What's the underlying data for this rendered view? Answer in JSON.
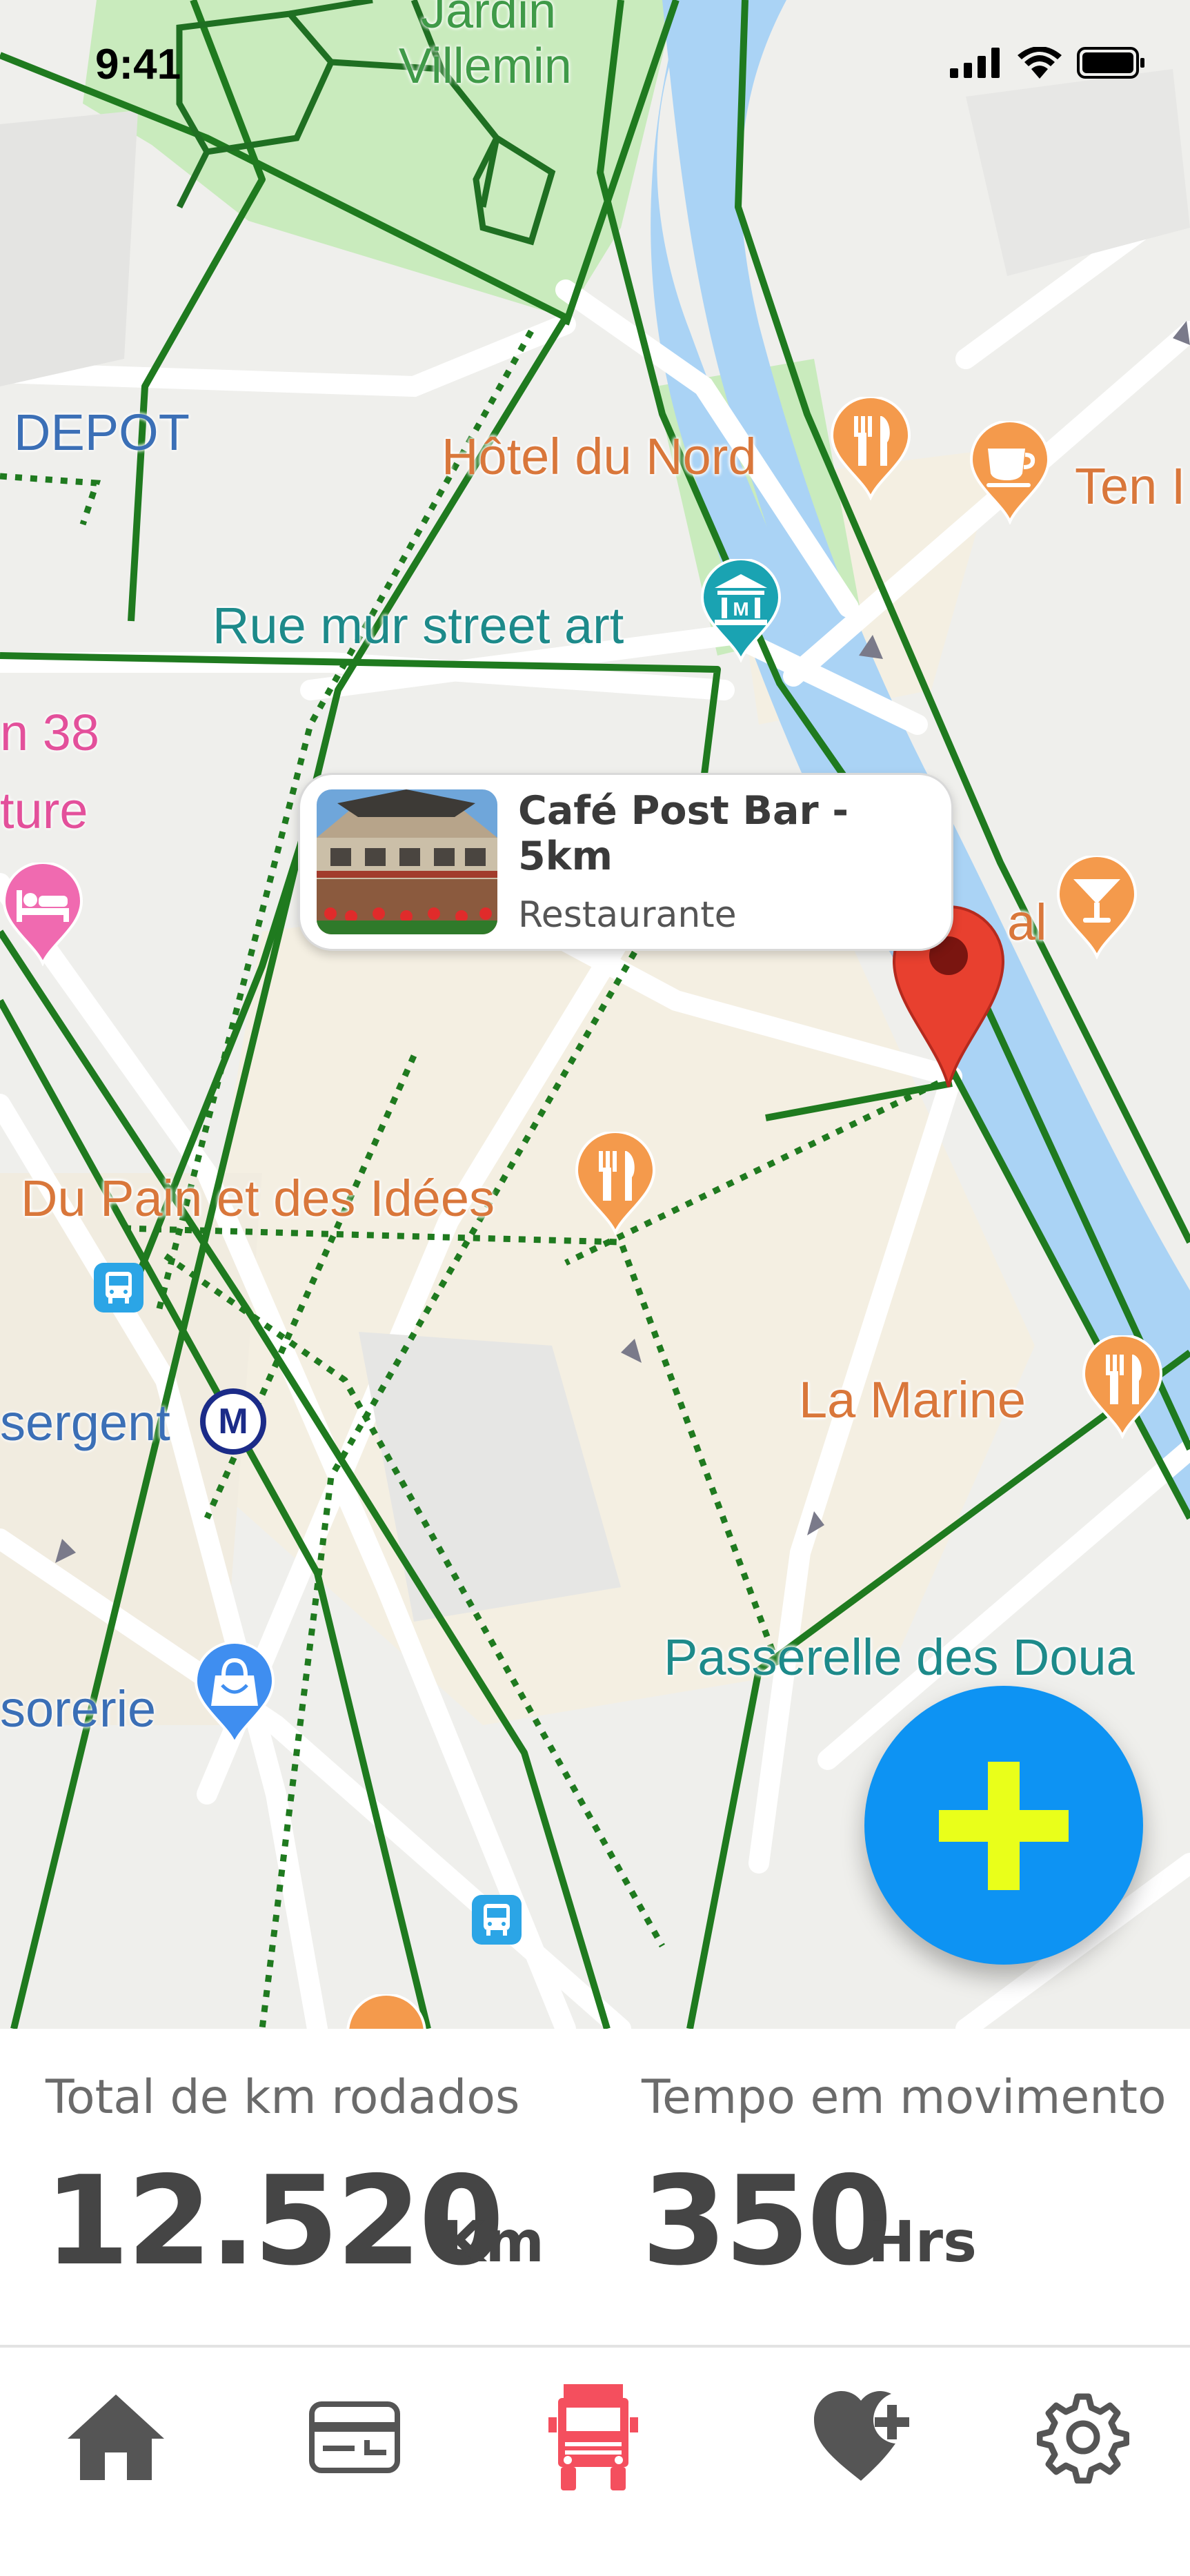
{
  "status_bar": {
    "time": "9:41"
  },
  "map": {
    "labels": {
      "jardin_villemin_1": "Jardin",
      "jardin_villemin_2": "Villemin",
      "depot": "DEPOT",
      "hotel_du_nord": "Hôtel du Nord",
      "ten": "Ten I",
      "rue_mur_street_art": "Rue mur street art",
      "pink_38": "n 38",
      "pink_ture": "ture",
      "al": "al",
      "du_pain": "Du Pain et des Idées",
      "la_marine": "La Marine",
      "sergent": "sergent",
      "passerelle": "Passerelle des Doua",
      "sorerie": "sorerie"
    },
    "metro_symbol": "M",
    "museum_symbol": "M",
    "icons": {
      "restaurant": "fork-knife-icon",
      "cafe": "coffee-cup-icon",
      "bar": "cocktail-icon",
      "hotel": "bed-icon",
      "museum": "museum-icon",
      "shop": "shopping-bag-icon",
      "bus": "bus-icon",
      "metro": "metro-icon",
      "pin": "map-pin-icon"
    }
  },
  "callout": {
    "title": "Café Post Bar - 5km",
    "subtitle": "Restaurante"
  },
  "fab": {
    "icon": "plus-icon",
    "color": "#0d93f3",
    "plus_color": "#e9ff1a"
  },
  "stats": {
    "distance": {
      "label": "Total de km rodados",
      "value": "12.520",
      "unit": "Km"
    },
    "time": {
      "label": "Tempo em movimento",
      "value": "350",
      "unit": "Hrs"
    }
  },
  "tabs": [
    {
      "icon": "home-icon",
      "active": false
    },
    {
      "icon": "card-icon",
      "active": false
    },
    {
      "icon": "truck-icon",
      "active": true
    },
    {
      "icon": "heart-plus-icon",
      "active": false
    },
    {
      "icon": "gear-icon",
      "active": false
    }
  ],
  "colors": {
    "accent": "#f44f5e",
    "inactive_icon": "#555555",
    "route_green": "#1f7a1f",
    "water": "#aad3f5",
    "park": "#c8ecc0"
  }
}
